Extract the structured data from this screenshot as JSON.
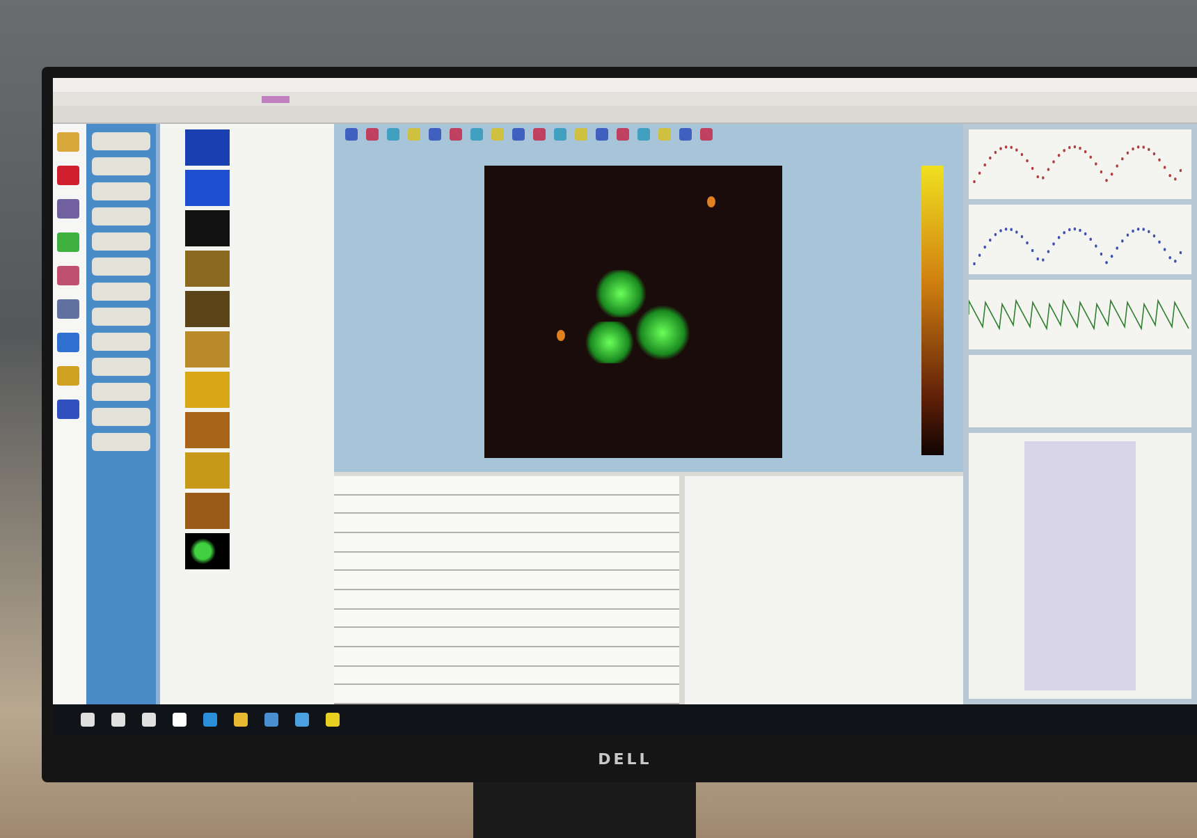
{
  "scene": {
    "kind": "photo-of-monitor"
  },
  "monitor": {
    "logo": "DELL"
  }
}
